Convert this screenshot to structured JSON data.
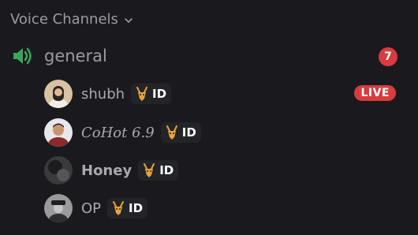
{
  "section": {
    "title": "Voice Channels"
  },
  "channel": {
    "name": "general",
    "badge": "7"
  },
  "users": [
    {
      "name": "shubh",
      "tag": "ID",
      "live": "LIVE"
    },
    {
      "name": "CoHot 6.9",
      "tag": "ID"
    },
    {
      "name": "Honey",
      "tag": "ID"
    },
    {
      "name": "OP",
      "tag": "ID"
    }
  ],
  "colors": {
    "background": "#1a1a1e",
    "speaker_green": "#3ba55c",
    "badge_red": "#d83c3e",
    "tag_bg": "#232428",
    "tag_icon_gold": "#e8a23a"
  },
  "icons": {
    "category_chevron": "chevron-down-icon",
    "channel": "speaker-icon",
    "tag": "antelope-icon"
  }
}
